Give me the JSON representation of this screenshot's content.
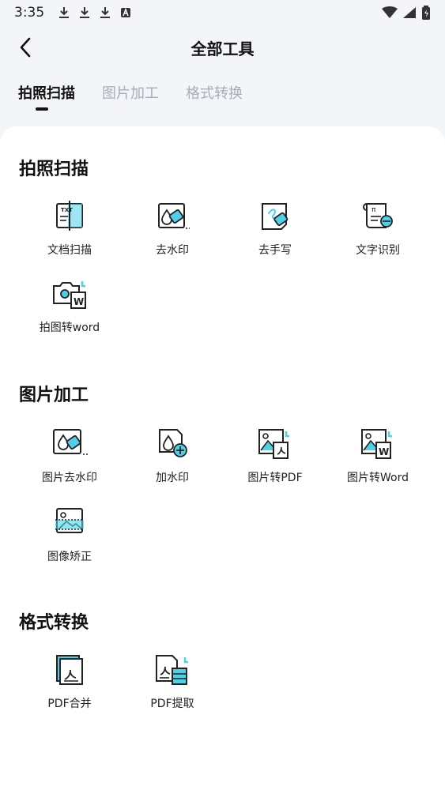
{
  "status_bar": {
    "time": "3:35"
  },
  "header": {
    "title": "全部工具"
  },
  "tabs": [
    {
      "label": "拍照扫描"
    },
    {
      "label": "图片加工"
    },
    {
      "label": "格式转换"
    }
  ],
  "sections": [
    {
      "title": "拍照扫描",
      "tools": [
        {
          "label": "文档扫描",
          "icon": "document-scan-icon"
        },
        {
          "label": "去水印",
          "icon": "remove-watermark-icon"
        },
        {
          "label": "去手写",
          "icon": "remove-handwriting-icon"
        },
        {
          "label": "文字识别",
          "icon": "text-recognition-icon"
        },
        {
          "label": "拍图转word",
          "icon": "photo-to-word-icon"
        }
      ]
    },
    {
      "title": "图片加工",
      "tools": [
        {
          "label": "图片去水印",
          "icon": "image-remove-watermark-icon"
        },
        {
          "label": "加水印",
          "icon": "add-watermark-icon"
        },
        {
          "label": "图片转PDF",
          "icon": "image-to-pdf-icon"
        },
        {
          "label": "图片转Word",
          "icon": "image-to-word-icon"
        },
        {
          "label": "图像矫正",
          "icon": "image-correction-icon"
        }
      ]
    },
    {
      "title": "格式转换",
      "tools": [
        {
          "label": "PDF合并",
          "icon": "pdf-merge-icon"
        },
        {
          "label": "PDF提取",
          "icon": "pdf-extract-icon"
        }
      ]
    }
  ],
  "colors": {
    "accent_cyan": "#4dd0e8",
    "text_dark": "#111111",
    "tab_inactive": "#a7adb8",
    "background": "#f4f5f8"
  }
}
